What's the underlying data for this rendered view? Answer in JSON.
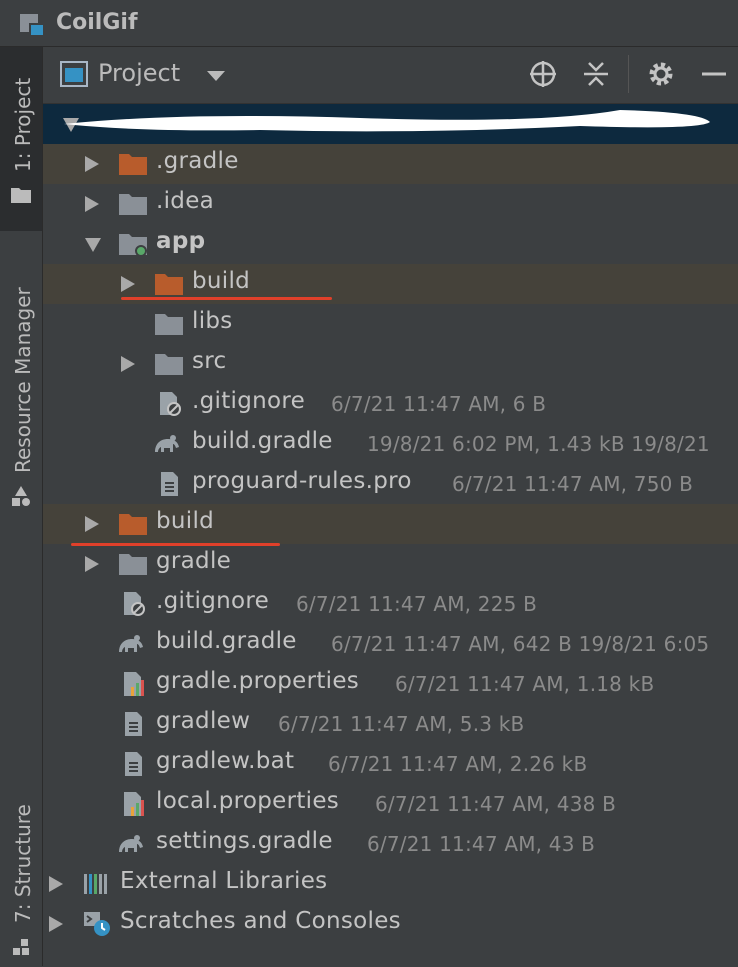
{
  "title_bar": {
    "project_name": "CoilGif"
  },
  "side_tabs": {
    "project": "1: Project",
    "resource_manager": "Resource Manager",
    "structure": "7: Structure"
  },
  "panel": {
    "view_label": "Project"
  },
  "tree": {
    "gradle_dir": ".gradle",
    "idea_dir": ".idea",
    "app": {
      "name": "app",
      "build": "build",
      "libs": "libs",
      "src": "src",
      "gitignore": {
        "name": ".gitignore",
        "meta": "6/7/21 11:47 AM, 6 B"
      },
      "build_gradle": {
        "name": "build.gradle",
        "meta": "19/8/21 6:02 PM, 1.43 kB 19/8/21"
      },
      "proguard": {
        "name": "proguard-rules.pro",
        "meta": "6/7/21 11:47 AM, 750 B"
      }
    },
    "build": "build",
    "gradle": "gradle",
    "gitignore": {
      "name": ".gitignore",
      "meta": "6/7/21 11:47 AM, 225 B"
    },
    "build_gradle": {
      "name": "build.gradle",
      "meta": "6/7/21 11:47 AM, 642 B 19/8/21 6:05"
    },
    "gradle_properties": {
      "name": "gradle.properties",
      "meta": "6/7/21 11:47 AM, 1.18 kB"
    },
    "gradlew": {
      "name": "gradlew",
      "meta": "6/7/21 11:47 AM, 5.3 kB"
    },
    "gradlew_bat": {
      "name": "gradlew.bat",
      "meta": "6/7/21 11:47 AM, 2.26 kB"
    },
    "local_properties": {
      "name": "local.properties",
      "meta": "6/7/21 11:47 AM, 438 B"
    },
    "settings_gradle": {
      "name": "settings.gradle",
      "meta": "6/7/21 11:47 AM, 43 B"
    },
    "external_libraries": "External Libraries",
    "scratches": "Scratches and Consoles"
  },
  "colors": {
    "folder_excluded": "#b85c2c",
    "folder": "#8a9097",
    "selection": "#0d293e",
    "highlight": "#45423a",
    "annotation": "#e0402a"
  }
}
